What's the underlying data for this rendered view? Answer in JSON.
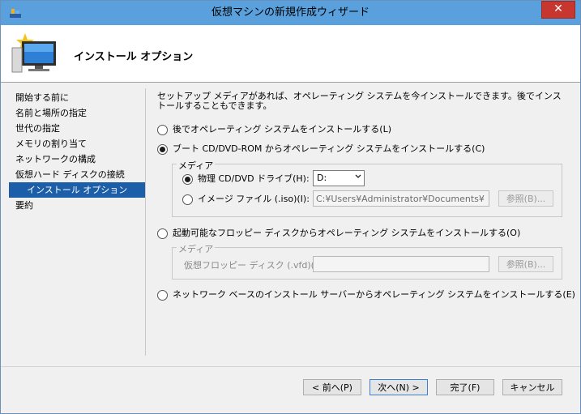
{
  "window": {
    "title": "仮想マシンの新規作成ウィザード",
    "close_label": "✕"
  },
  "header": {
    "title": "インストール オプション"
  },
  "nav": {
    "items": [
      {
        "label": "開始する前に",
        "active": false,
        "sub": false
      },
      {
        "label": "名前と場所の指定",
        "active": false,
        "sub": false
      },
      {
        "label": "世代の指定",
        "active": false,
        "sub": false
      },
      {
        "label": "メモリの割り当て",
        "active": false,
        "sub": false
      },
      {
        "label": "ネットワークの構成",
        "active": false,
        "sub": false
      },
      {
        "label": "仮想ハード ディスクの接続",
        "active": false,
        "sub": false
      },
      {
        "label": "インストール オプション",
        "active": true,
        "sub": true
      },
      {
        "label": "要約",
        "active": false,
        "sub": false
      }
    ]
  },
  "content": {
    "intro": "セットアップ メディアがあれば、オペレーティング システムを今インストールできます。後でインストールすることもできます。",
    "options": {
      "later": {
        "label": "後でオペレーティング システムをインストールする(L)",
        "selected": false
      },
      "cd": {
        "label": "ブート CD/DVD-ROM からオペレーティング システムをインストールする(C)",
        "selected": true
      },
      "floppy": {
        "label": "起動可能なフロッピー ディスクからオペレーティング システムをインストールする(O)",
        "selected": false
      },
      "network": {
        "label": "ネットワーク ベースのインストール サーバーからオペレーティング システムをインストールする(E)",
        "selected": false
      }
    },
    "cd_media": {
      "group_title": "メディア",
      "physical_label": "物理 CD/DVD ドライブ(H):",
      "physical_value": "D:",
      "image_label": "イメージ ファイル (.iso)(I):",
      "image_value": "C:¥Users¥Administrator¥Documents¥",
      "browse_label": "参照(B)..."
    },
    "floppy_media": {
      "group_title": "メディア",
      "vfd_label": "仮想フロッピー ディスク (.vfd)(V):",
      "vfd_value": "",
      "browse_label": "参照(B)..."
    }
  },
  "footer": {
    "prev_label": "< 前へ(P)",
    "next_label": "次へ(N) >",
    "finish_label": "完了(F)",
    "cancel_label": "キャンセル"
  },
  "colors": {
    "titlebar": "#5aa0dc",
    "nav_active": "#1c5fa8",
    "close": "#c7372f"
  }
}
